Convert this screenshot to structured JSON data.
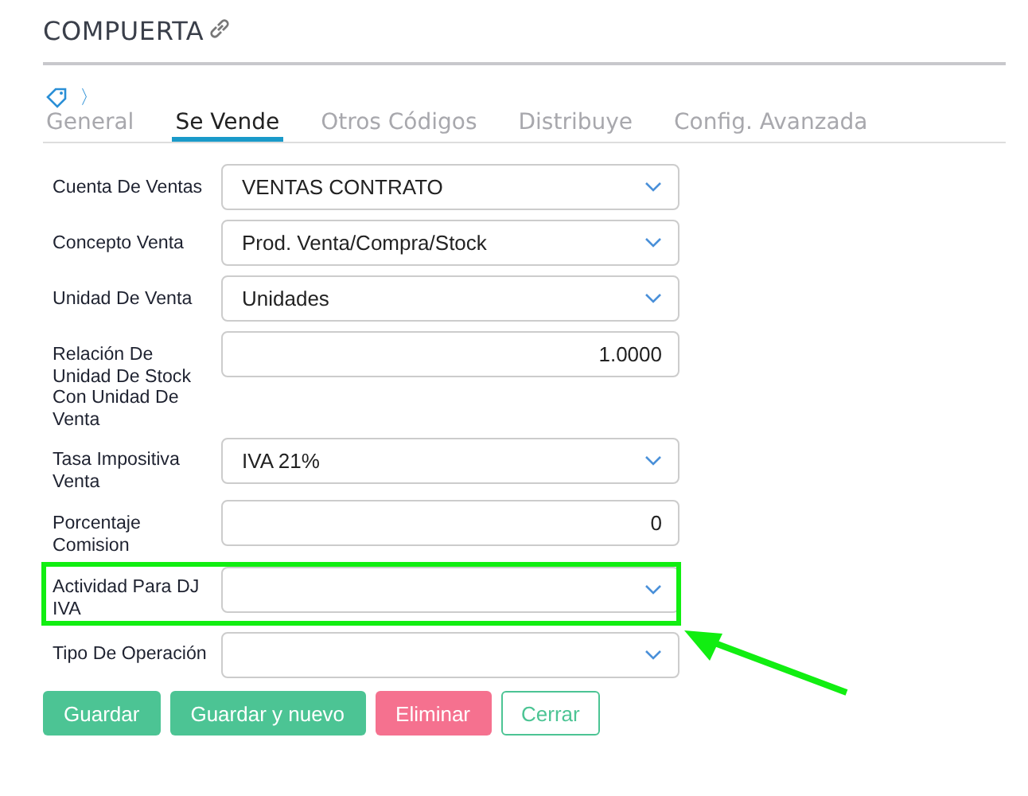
{
  "title": "COMPUERTA",
  "breadcrumb": {
    "separator": "〉"
  },
  "tabs": [
    {
      "label": "General",
      "selected": false
    },
    {
      "label": "Se Vende",
      "selected": true
    },
    {
      "label": "Otros Códigos",
      "selected": false
    },
    {
      "label": "Distribuye",
      "selected": false
    },
    {
      "label": "Config. Avanzada",
      "selected": false
    }
  ],
  "fields": [
    {
      "label": "Cuenta De Ventas",
      "kind": "select",
      "value": "VENTAS CONTRATO",
      "highlighted": false
    },
    {
      "label": "Concepto Venta",
      "kind": "select",
      "value": "Prod. Venta/Compra/Stock",
      "highlighted": false
    },
    {
      "label": "Unidad De Venta",
      "kind": "select",
      "value": "Unidades",
      "highlighted": false
    },
    {
      "label": "Relación De Unidad De Stock Con Unidad De Venta",
      "kind": "number",
      "value": "1.0000",
      "highlighted": false
    },
    {
      "label": "Tasa Impositiva Venta",
      "kind": "select",
      "value": "IVA 21%",
      "highlighted": false
    },
    {
      "label": "Porcentaje Comision",
      "kind": "number",
      "value": "0",
      "highlighted": false
    },
    {
      "label": "Actividad Para DJ IVA",
      "kind": "select",
      "highlighted": true
    },
    {
      "label": "Tipo De Operación",
      "kind": "select",
      "highlighted": false
    }
  ],
  "buttons": [
    {
      "label": "Guardar",
      "kind": "primary"
    },
    {
      "label": "Guardar y nuevo",
      "kind": "primary"
    },
    {
      "label": "Eliminar",
      "kind": "danger"
    },
    {
      "label": "Cerrar",
      "kind": "outline"
    }
  ],
  "annotation": {
    "kind": "arrow"
  }
}
